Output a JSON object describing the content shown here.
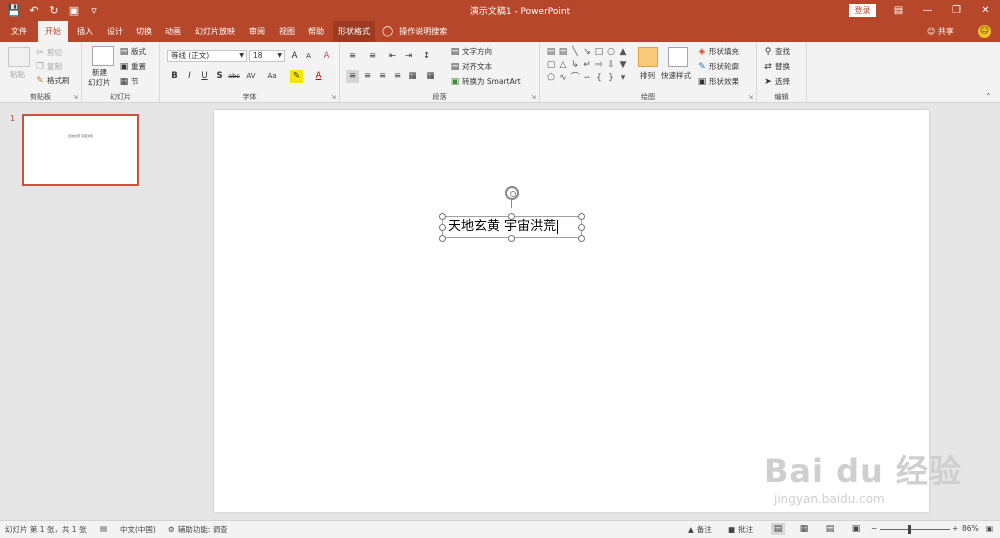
{
  "window": {
    "title": "演示文稿1  -  PowerPoint",
    "login_label": "登录",
    "qat": {
      "save_icon": "save-icon",
      "undo_icon": "undo-icon",
      "redo_icon": "redo-icon",
      "present_icon": "present-from-start-icon",
      "more_icon": "customize-qat-icon"
    },
    "controls": {
      "ribbon_display": "ribbon-display-icon",
      "minimize": "minimize-icon",
      "restore": "restore-icon",
      "close": "close-icon"
    }
  },
  "tabs": [
    {
      "label": "文件"
    },
    {
      "label": "开始"
    },
    {
      "label": "插入"
    },
    {
      "label": "设计"
    },
    {
      "label": "切换"
    },
    {
      "label": "动画"
    },
    {
      "label": "幻灯片放映"
    },
    {
      "label": "审阅"
    },
    {
      "label": "视图"
    },
    {
      "label": "帮助"
    },
    {
      "label": "形状格式"
    }
  ],
  "tell_me": "操作说明搜索",
  "share": "共享",
  "ribbon": {
    "clipboard": {
      "label": "剪贴板",
      "paste": "粘贴",
      "cut": "剪切",
      "copy": "复制",
      "format_painter": "格式刷"
    },
    "slides": {
      "label": "幻灯片",
      "new_slide_1": "新建",
      "new_slide_2": "幻灯片",
      "layout": "版式",
      "reset": "重置",
      "section": "节"
    },
    "font": {
      "label": "字体",
      "font_name": "等线 (正文)",
      "font_size": "18",
      "bold": "B",
      "italic": "I",
      "underline": "U",
      "shadow": "S",
      "strike": "abc",
      "spacing": "AV",
      "case": "Aa",
      "grow": "A",
      "shrink": "A",
      "clear": "A",
      "color": "A"
    },
    "paragraph": {
      "label": "段落",
      "text_direction": "文字方向",
      "align_text": "对齐文本",
      "smartart": "转换为 SmartArt"
    },
    "drawing": {
      "label": "绘图",
      "arrange": "排列",
      "quick_styles": "快速样式",
      "shape_fill": "形状填充",
      "shape_outline": "形状轮廓",
      "shape_effects": "形状效果"
    },
    "editing": {
      "label": "编辑",
      "find": "查找",
      "replace": "替换",
      "select": "选择"
    }
  },
  "slides_pane": {
    "slide_number": "1"
  },
  "slide": {
    "text": "天地玄黄 宇宙洪荒"
  },
  "statusbar": {
    "slide_info": "幻灯片 第 1 张，共 1 张",
    "language": "中文(中国)",
    "accessibility": "辅助功能: 调查",
    "notes": "备注",
    "comments": "批注",
    "zoom": "86%"
  },
  "watermark": {
    "main": "Bai du 经验",
    "sub": "jingyan.baidu.com"
  },
  "colors": {
    "accent": "#b7472a",
    "ribbon_bg": "#f3f3f3",
    "canvas_bg": "#e6e6e6"
  }
}
